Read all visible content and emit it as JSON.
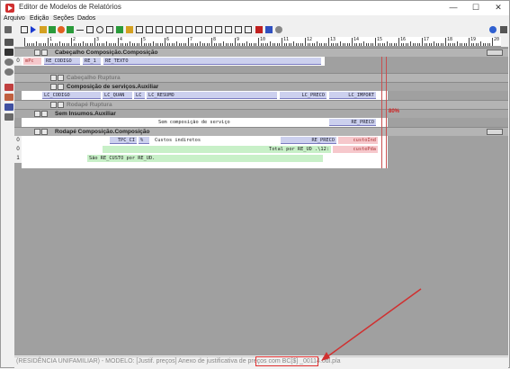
{
  "window": {
    "title": "Editor de Modelos de Relatórios",
    "controls": {
      "minimize": "—",
      "maximize": "☐",
      "close": "✕"
    }
  },
  "menu": {
    "items": [
      "Arquivo",
      "Edição",
      "Seções",
      "Dados"
    ]
  },
  "ruler": {
    "marks": [
      "1",
      "2",
      "3",
      "4",
      "5",
      "6",
      "7",
      "8",
      "9",
      "10",
      "11",
      "12",
      "13",
      "14",
      "15",
      "16",
      "17",
      "18",
      "19",
      "20"
    ]
  },
  "bands": {
    "cabecalho_composicao": "Cabeçalho Composição.Composição",
    "cabecalho_ruptura": "Cabeçalho Ruptura",
    "composicao_servicos": "Composição de serviços.Auxiliar",
    "rodape_ruptura": "Rodapé Ruptura",
    "sem_insumos": "Sem Insumos.Auxiliar",
    "rodape_composicao": "Rodapé Composição.Composição"
  },
  "gutter": {
    "g1": "0",
    "g2": "0",
    "g3": "0",
    "g4": "1"
  },
  "fields": {
    "cab_mpc": "​mPc",
    "cab_codigo": "RE_CODIGO",
    "cab_re1": "RE_1",
    "cab_texto": "RE_TEXTO",
    "lc_codigo": "LC_CODIGO",
    "lc_quan": "LC_QUAN",
    "lc": "LC",
    "lc_resumo": "LC_RESUMO",
    "lc_preco": "LC_PRECO",
    "lc_import": "LC_IMPORT",
    "sem_comp": "Sem composição de serviço",
    "re_preco": "RE_PRECO",
    "tpc_ci": "TPC_CI",
    "pct": "%",
    "custos_indiretos": "Custos indiretos",
    "re_preco2": "RE_PRECO",
    "custo_ind": "custoInd",
    "total_por": "Total por RE_UD .\\12:",
    "custo_pda": "custePda",
    "sao_re_custo": "São RE_CUSTO por RE_UD."
  },
  "annotations": {
    "pct_note": "80%"
  },
  "status": {
    "text": "(RESIDÊNCIA UNIFAMILIAR) - MODELO: [Justif. preços] Anexo de justificativa de preços com BC[$] _00114.0dl.pla"
  },
  "colors": {
    "highlight": "#e03030",
    "band": "#b4b4b4",
    "field_blue": "#ccd0ee",
    "field_pink": "#f6c8cc",
    "field_green": "#c8f0c8"
  }
}
